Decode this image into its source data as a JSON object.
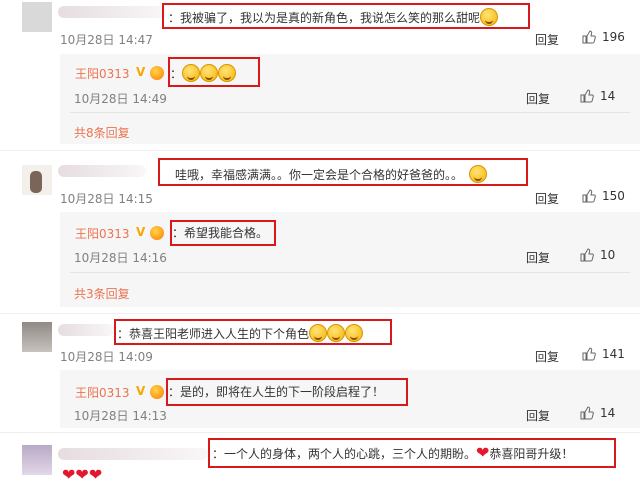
{
  "comments": [
    {
      "text": "：我被骗了，我以为是真的新角色，我说怎么笑的那么甜呢",
      "time": "10月28日 14:47",
      "reply_label": "回复",
      "likes": "196",
      "sub": {
        "user": "王阳0313",
        "text": "：",
        "time": "10月28日 14:49",
        "reply_label": "回复",
        "likes": "14"
      },
      "more": "共8条回复"
    },
    {
      "text": "哇哦，幸福感满满。。你一定会是个合格的好爸爸的。。",
      "time": "10月28日 14:15",
      "reply_label": "回复",
      "likes": "150",
      "sub": {
        "user": "王阳0313",
        "text": "：希望我能合格。",
        "time": "10月28日 14:16",
        "reply_label": "回复",
        "likes": "10"
      },
      "more": "共3条回复"
    },
    {
      "text": "：恭喜王阳老师进入人生的下个角色",
      "time": "10月28日 14:09",
      "reply_label": "回复",
      "likes": "141",
      "sub": {
        "user": "王阳0313",
        "text": "：是的，即将在人生的下一阶段启程了！",
        "time": "10月28日 14:13",
        "reply_label": "回复",
        "likes": "14"
      }
    },
    {
      "text": "：一个人的身体，两个人的心跳，三个人的期盼。",
      "text2": "恭喜阳哥升级！"
    }
  ],
  "icons": {
    "like": "thumbs-up-icon",
    "emoji": "grin-emoji",
    "heart": "heart-emoji",
    "verified": "verified-v-icon",
    "member": "member-crown-icon"
  },
  "colors": {
    "username": "#eb7350",
    "highlight_box": "#d8191c",
    "meta": "#808080",
    "subbg": "#f6f6f6"
  }
}
